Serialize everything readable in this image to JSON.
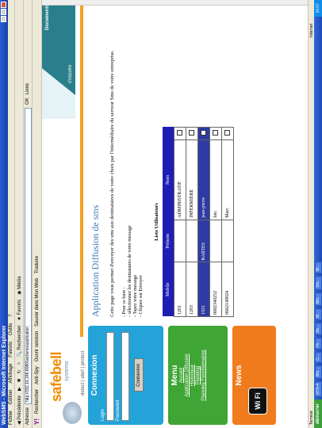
{
  "window": {
    "title": "WebSMS - Microsoft Internet Explorer"
  },
  "menubar": [
    "Fichier",
    "Edition",
    "Affichage",
    "Favoris",
    "Outils",
    "?"
  ],
  "toolbar": {
    "back": "Précédente",
    "search": "Rechercher",
    "favorites": "Favoris",
    "media": "Média"
  },
  "address": {
    "label": "Adresse",
    "url": "http://192.16.246:8080/websms/application",
    "go": "OK",
    "links": "Liens"
  },
  "yahoo_bar": {
    "brand": "Y!",
    "search": "Rechercher",
    "anti_spy": "Anti-Spy",
    "open_session": "Ouvrir session",
    "save_web": "Sauver dans Mon Web",
    "translate": "Traduire"
  },
  "site": {
    "logo": "safebell",
    "logo_sub": "systems",
    "tagline": "detect | alert | protect",
    "banner_inscrire": "s'inscrire",
    "banner_docs": "Documents"
  },
  "login": {
    "title": "Connexion",
    "login_label": "Login",
    "password_label": "Password",
    "button": "Connexion"
  },
  "menu": {
    "title": "Menu",
    "links": [
      "Accueil",
      "Application Diffusion",
      "Historique",
      "Planning",
      "Planning Fonctionnaires"
    ]
  },
  "news": {
    "title": "News",
    "badge": "Wi Fi"
  },
  "main": {
    "title": "Application Diffusion de sms",
    "intro": "Cette page vous permet d'envoyer des sms aux destinataires de votre choix par l'intermédiaire du serveur Sms de votre entreprise.",
    "steps_header": "- Pour ce faire :",
    "steps": [
      "- sélectionnez les destinataires de votre message",
      "- Tapez votre message",
      "- Cliquez sur Envoyer"
    ],
    "table_title": "Liste Utilisateurs",
    "columns": [
      "Mobile",
      "Prénom",
      "Nom"
    ],
    "rows": [
      {
        "mobile": "1201",
        "prenom": "",
        "nom": "ADMINISTRATIF",
        "selected": false
      },
      {
        "mobile": "1203",
        "prenom": "",
        "nom": "INFERMIERE",
        "selected": false
      },
      {
        "mobile": "1021",
        "prenom": "BARTES",
        "nom": "jean-pierre",
        "selected": true
      },
      {
        "mobile": "0682340252",
        "prenom": "",
        "nom": "loic",
        "selected": false
      },
      {
        "mobile": "0662149024",
        "prenom": "",
        "nom": "Marc",
        "selected": false
      }
    ]
  },
  "status": {
    "left": "Terminé",
    "zone": "Internet"
  },
  "taskbar": {
    "start": "démarrer",
    "items": [
      "STS-4",
      "Mo...",
      "C...",
      "Hi...",
      "Se...",
      "M...",
      "Wo...",
      "Sm...",
      "W..."
    ],
    "clock": "16:07"
  }
}
